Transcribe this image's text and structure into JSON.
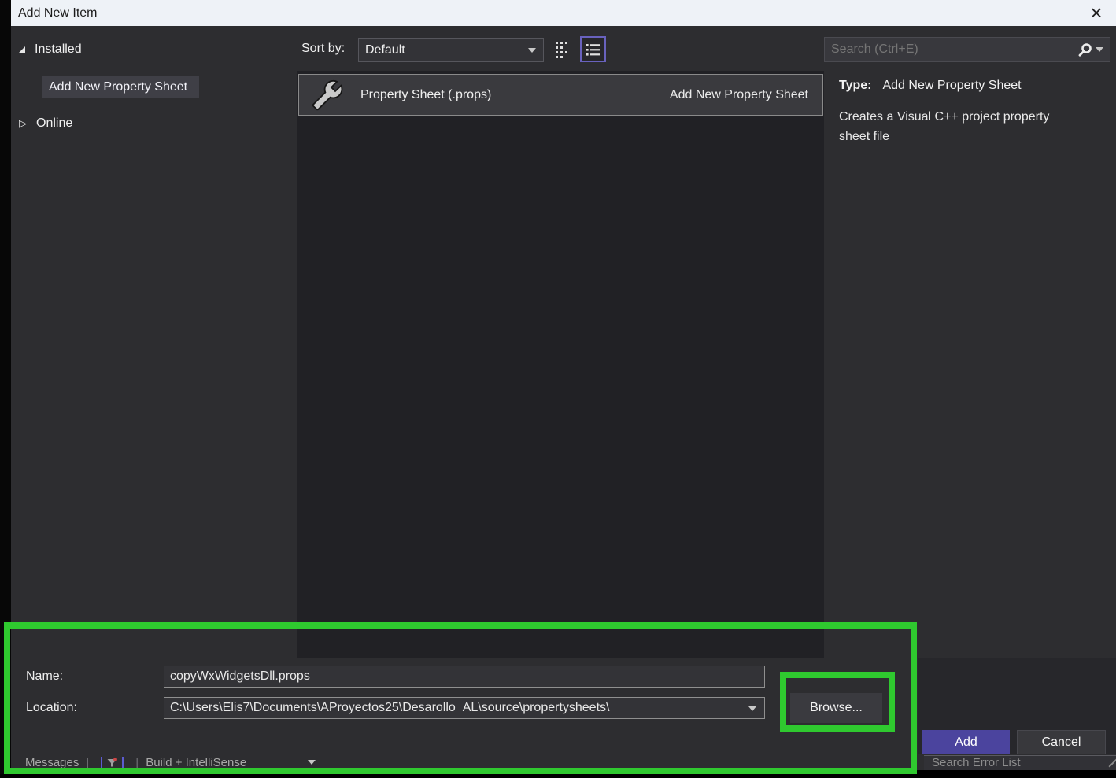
{
  "title_bar": {
    "title": "Add New Item",
    "close_glyph": "×"
  },
  "sidebar": {
    "groups": [
      {
        "label": "Installed",
        "state": "expanded"
      },
      {
        "label": "Online",
        "state": "collapsed",
        "glyph": "▷"
      }
    ],
    "selected_item": "Add New Property Sheet"
  },
  "toolbar": {
    "sort_label": "Sort by:",
    "sort_value": "Default",
    "search_placeholder": "Search (Ctrl+E)"
  },
  "template_list": {
    "items": [
      {
        "name": "Property Sheet (.props)",
        "tag": "Add New Property Sheet",
        "icon": "wrench-icon",
        "selected": true
      }
    ]
  },
  "details": {
    "type_label": "Type:",
    "type_value": "Add New Property Sheet",
    "description": "Creates a Visual C++ project property sheet file"
  },
  "form": {
    "name_label": "Name:",
    "name_value": "copyWxWidgetsDll.props",
    "location_label": "Location:",
    "location_value": "C:\\Users\\Elis7\\Documents\\AProyectos25\\Desarollo_AL\\source\\propertysheets\\",
    "browse_label": "Browse...",
    "add_label": "Add",
    "cancel_label": "Cancel"
  },
  "background_ui": {
    "messages_label": "Messages",
    "pipe": "|",
    "filter_dropdown_label": "Build + IntelliSense",
    "error_search_placeholder": "Search Error List"
  },
  "colors": {
    "accent_purple": "#6962BE",
    "add_button_purple": "#4B449E",
    "annotation_green": "#2FC92F",
    "titlebar_bg": "#EEF2F7",
    "dialog_bg": "#2D2D30",
    "list_bg": "#212125"
  }
}
